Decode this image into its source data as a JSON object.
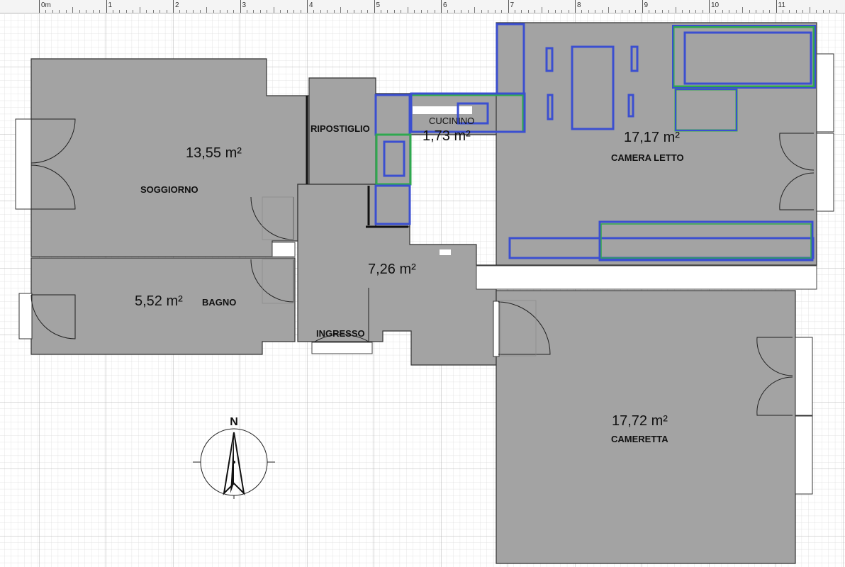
{
  "ruler": {
    "labels": [
      "0m",
      "1",
      "2",
      "3",
      "4",
      "5",
      "6",
      "7",
      "8",
      "9",
      "10",
      "11"
    ]
  },
  "rooms": {
    "soggiorno": {
      "name": "SOGGIORNO",
      "area": "13,55 m²"
    },
    "ripostiglio": {
      "name": "RIPOSTIGLIO"
    },
    "cucina": {
      "name": "CUCININO",
      "area": "1,73 m²"
    },
    "camera_letto": {
      "name": "CAMERA LETTO",
      "area": "17,17 m²"
    },
    "bagno": {
      "name": "BAGNO",
      "area": "5,52 m²"
    },
    "ingresso": {
      "name": "INGRESSO",
      "area": "7,26 m²"
    },
    "cameretta": {
      "name": "CAMERETTA",
      "area": "17,72 m²"
    }
  },
  "compass": {
    "label": "N"
  },
  "colors": {
    "floor": "#a3a3a3",
    "grid": "#d6d6d6",
    "furniture_outline": "#3b4fd0",
    "furniture_alt": "#2fa84f"
  }
}
